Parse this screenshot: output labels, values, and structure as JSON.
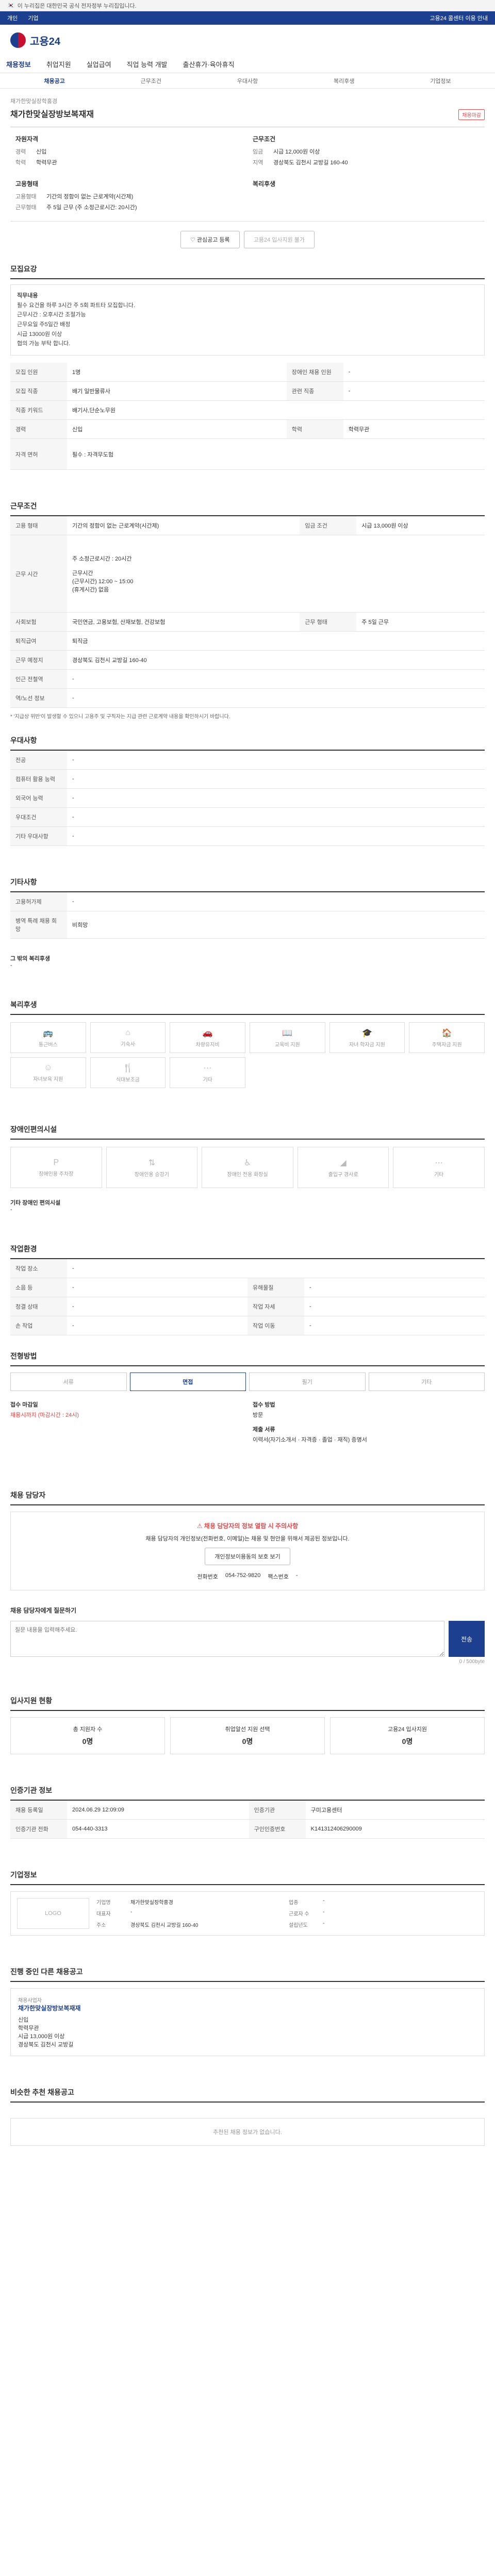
{
  "topbar": {
    "gov_notice": "이 누리집은 대한민국 공식 전자정부 누리집입니다."
  },
  "bluebar": {
    "left_a": "개인",
    "left_b": "기업",
    "right": "고용24 콜센터 이용 안내"
  },
  "logo": {
    "text": "고용24"
  },
  "gnb": {
    "items": [
      "채용정보",
      "취업지원",
      "실업급여",
      "직업 능력 개발",
      "출산휴가·육아휴직"
    ]
  },
  "lnb": {
    "items": [
      "채용공고",
      "근무조건",
      "우대사항",
      "복리후생",
      "기업정보"
    ]
  },
  "job": {
    "company_small": "채가한맞실장학홍경",
    "title": "채가한맞실장방보복재재",
    "closed": "채용마감"
  },
  "summary": {
    "left_h": "자원자격",
    "left": [
      {
        "k": "경력",
        "v": "신입"
      },
      {
        "k": "학력",
        "v": "학력무관"
      }
    ],
    "right_h": "근무조건",
    "right": [
      {
        "k": "임금",
        "v": "시급 12,000원 이상"
      },
      {
        "k": "지역",
        "v": "경상북도 김천시 교방길 160-40"
      }
    ],
    "left2_h": "고용형태",
    "left2": [
      {
        "k": "고용형태",
        "v": "기간의 정함이 없는 근로계약(시간제)"
      },
      {
        "k": "근무형태",
        "v": "주 5일 근무 (주 소정근로시간: 20시간)"
      }
    ],
    "right2_h": "복리후생",
    "right2": []
  },
  "buttons": {
    "save": "관심공고 등록",
    "apply": "고용24 입사지원 불가"
  },
  "intro": {
    "h": "모집요강",
    "lines": [
      "직무내용",
      "필수 요건을 하루 3시간 주 5회 파트타 모집합니다.",
      "근무시간 : 오후시간 조절가능",
      "근무요일 주5일간 배정",
      "시급 13000원 이상",
      "협의 가능 부탁 합니다."
    ]
  },
  "recruit": {
    "rows": [
      {
        "k1": "모집 인원",
        "v1": "1명",
        "k2": "장애인 채용 인원",
        "v2": "-"
      },
      {
        "k1": "모집 직종",
        "v1": "배기 일반물류사",
        "k2": "관련 직종",
        "v2": "-"
      },
      {
        "k1": "직종 키워드",
        "v1": "배기사,단순노무원",
        "k2": "",
        "v2": ""
      },
      {
        "k1": "경력",
        "v1": "신입",
        "k2": "학력",
        "v2": "학력무관"
      },
      {
        "k1": "자격 면허",
        "v1": "필수 : 자격무도험",
        "k2": "",
        "v2": ""
      }
    ]
  },
  "conditions": {
    "h": "근무조건",
    "employ_type": "기간의 정함이 없는 근로계약(시간제)",
    "wage": "시급 13,000원 이상",
    "hours_label": "근무 시간",
    "hours": [
      "주 소정근로시간 : 20시간",
      "근무시간",
      "(근무시간) 12:00 ~ 15:00",
      "(휴게시간) 없음"
    ],
    "insurance": "국민연금, 고용보험, 산재보험, 건강보험",
    "work_form": "주 5일 근무",
    "retire": "퇴직금",
    "location": "경상북도 김천시 교방길 160-40",
    "subway": "-",
    "station": "-",
    "notice": "* '지급상 위반'이 발생할 수 있으니 고용주 및 구직자는 지급 관련 근로계약 내용을 확인하시기 바랍니다."
  },
  "preference": {
    "h": "우대사항",
    "rows": [
      {
        "k": "전공",
        "v": "-"
      },
      {
        "k": "컴퓨터 활용 능력",
        "v": "-"
      },
      {
        "k": "외국어 능력",
        "v": "-"
      },
      {
        "k": "우대조건",
        "v": "-"
      },
      {
        "k": "기타 우대사항",
        "v": "-"
      }
    ]
  },
  "etc": {
    "h": "기타사항",
    "rows": [
      {
        "k": "고용허가제",
        "v": "-"
      },
      {
        "k": "병역 특례 채용 희망",
        "v": "비희망"
      }
    ],
    "welfare_note_h": "그 밖의 복리후생",
    "welfare_note": "-"
  },
  "welfare": {
    "h": "복리후생",
    "items": [
      "통근버스",
      "기숙사",
      "차량유지비",
      "교육비 지원",
      "자녀 학자금 지원",
      "주택자금 지원",
      "자녀보육 지원",
      "식대보조금",
      "기타"
    ]
  },
  "disability": {
    "h": "장애인편의시설",
    "items": [
      "장애인용 주차장",
      "장애인용 승강기",
      "장애인 전용 화장실",
      "출입구 경사로",
      "기타"
    ],
    "note_h": "기타 장애인 편의시설",
    "note": "-"
  },
  "work_env": {
    "h": "작업환경",
    "rows": [
      {
        "k1": "작업 장소",
        "v1": "-",
        "k2": "",
        "v2": ""
      },
      {
        "k1": "소음 등",
        "v1": "-",
        "k2": "유해물질",
        "v2": "-"
      },
      {
        "k1": "청결 상태",
        "v1": "-",
        "k2": "작업 자세",
        "v2": "-"
      },
      {
        "k1": "손 작업",
        "v1": "-",
        "k2": "작업 이동",
        "v2": "-"
      }
    ]
  },
  "process": {
    "h": "전형방법",
    "steps": [
      "서류",
      "면접",
      "필기",
      "기타"
    ],
    "receipt_h": "접수 마감일",
    "receipt": "채용시까지 (마감시간 : 24시)",
    "method_h": "접수 방법",
    "method": "방문",
    "docs_h": "제출 서류",
    "docs": "이력서(자기소개서 · 자격증 · 졸업 · 재직) 증명서"
  },
  "manager": {
    "h": "채용 담당자",
    "warn": "채용 담당자의 정보 열람 시 주의사항",
    "text": "채용 담당자의 개인정보(전화번호, 이메일)는 채용 및 현안을 위해서 제공된 정보입니다.",
    "btn": "개인정보이용동의 보호 보기",
    "phone_label": "전화번호",
    "phone": "054-752-9820",
    "fax_label": "팩스번호",
    "fax": "-"
  },
  "inquiry": {
    "h": "채용 담당자에게 질문하기",
    "placeholder": "질문 내용을 입력해주세요.",
    "send": "전송",
    "count": "0 / 500byte"
  },
  "apply_stats": {
    "h": "입사지원 현황",
    "items": [
      {
        "label": "총 지원자 수",
        "v": "0명"
      },
      {
        "label": "취업알선 지원 선택",
        "v": "0명"
      },
      {
        "label": "고용24 입사지원",
        "v": "0명"
      }
    ]
  },
  "info": {
    "h": "인증기관 정보",
    "rows": [
      {
        "k1": "채용 등록일",
        "v1": "2024.06.29 12:09:09",
        "k2": "인증기관",
        "v2": "구미고용센터"
      },
      {
        "k1": "인증기관 전화",
        "v1": "054-440-3313",
        "k2": "구인인증번호",
        "v2": "K141312406290009"
      }
    ]
  },
  "company": {
    "h": "기업정보",
    "logo": "LOGO",
    "rows": [
      {
        "k1": "기업명",
        "v1": "채가한맞실장학홍경",
        "k2": "업종",
        "v2": "-"
      },
      {
        "k1": "대표자",
        "v1": "-",
        "k2": "근로자 수",
        "v2": "-"
      },
      {
        "k1": "주소",
        "v1": "경상북도 김천시 교방길 160-40",
        "k2": "설립년도",
        "v2": "-"
      }
    ]
  },
  "similar": {
    "h": "진행 중인 다른 채용공고",
    "company": "채용사업자",
    "title": "채가한맞실장방보복재재",
    "lines": [
      "신입",
      "학력무관",
      "시급 13,000원 이상",
      "경상북도 김천시 교방길"
    ]
  },
  "recommend": {
    "h": "비슷한 추천 채용공고",
    "empty": "추천된 채용 정보가 없습니다."
  }
}
